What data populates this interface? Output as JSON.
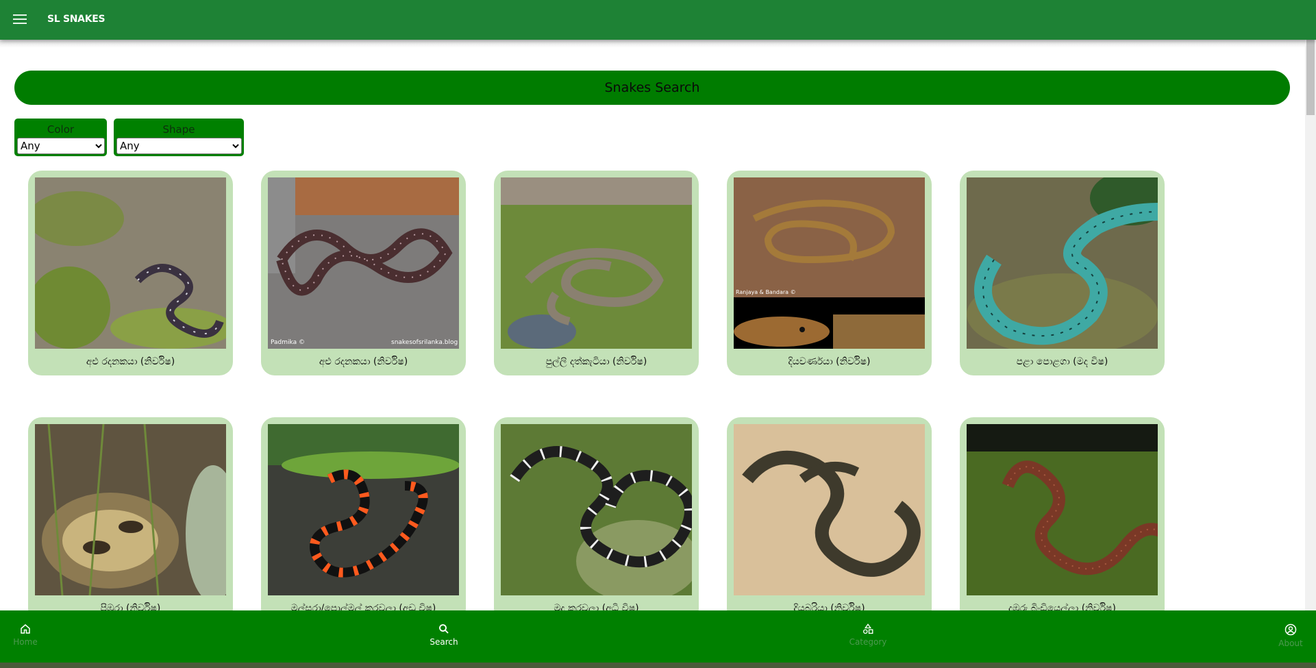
{
  "app": {
    "title": "SL SNAKES"
  },
  "search": {
    "title": "Snakes Search"
  },
  "filters": {
    "color": {
      "label": "Color",
      "selected": "Any"
    },
    "shape": {
      "label": "Shape",
      "selected": "Any"
    }
  },
  "cards": [
    {
      "name": "අළු රදනකයා (නිර්විෂ)",
      "photo": "snake-photo",
      "photo_credit": ""
    },
    {
      "name": "අළු රදනකයා (නිර්විෂ)",
      "photo": "snake-photo",
      "photo_credit": "Padmika © snakesofsrilanka.blog"
    },
    {
      "name": "පුල්ලි දත්කැටියා (නිර්විෂ)",
      "photo": "snake-photo",
      "photo_credit": ""
    },
    {
      "name": "දියවර්ණයා (නිර්විෂ)",
      "photo": "snake-photo",
      "photo_credit": "Ranjaya & Bandara ©"
    },
    {
      "name": "පළා පොළගා (මද විෂ)",
      "photo": "snake-photo",
      "photo_credit": ""
    },
    {
      "name": "පිඹුරා (නිර්විෂ)",
      "photo": "snake-photo",
      "photo_credit": ""
    },
    {
      "name": "මල්සරා/පොල්මල් කරවලා (අඩු විෂ)",
      "photo": "snake-photo",
      "photo_credit": ""
    },
    {
      "name": "මුදු කරවලා (අධි විෂ)",
      "photo": "snake-photo",
      "photo_credit": ""
    },
    {
      "name": "දියබරියා (නිර්විෂ)",
      "photo": "snake-photo",
      "photo_credit": ""
    },
    {
      "name": "දුඹුරු බිංඩියෙල්ලා (නිර්විෂ)",
      "photo": "snake-photo",
      "photo_credit": ""
    }
  ],
  "nav": {
    "home": {
      "label": "Home",
      "icon": "home-icon"
    },
    "search": {
      "label": "Search",
      "icon": "search-icon"
    },
    "category": {
      "label": "Category",
      "icon": "category-icon"
    },
    "about": {
      "label": "About",
      "icon": "account-circle-icon"
    }
  },
  "colors": {
    "topbar": "#1e8235",
    "accent": "#008000",
    "card": "#c3e1b7"
  }
}
